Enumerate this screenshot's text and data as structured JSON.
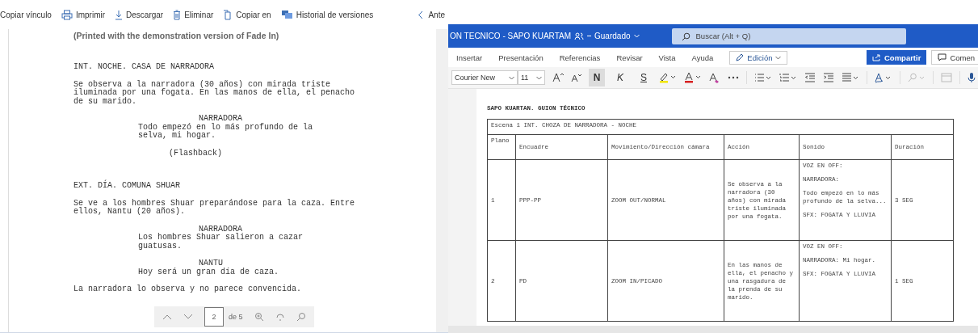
{
  "pdf_viewer": {
    "toolbar": [
      "Copiar vínculo",
      "Imprimir",
      "Descargar",
      "Eliminar",
      "Copiar en",
      "Historial de versiones"
    ],
    "back_link": "Ante",
    "notice": "(Printed with the demonstration version of Fade In)",
    "script": [
      {
        "kind": "heading",
        "text": "INT. NOCHE. CASA DE NARRADORA"
      },
      {
        "kind": "action",
        "text": "Se observa a la narradora (30 años) con mirada triste\niluminada por una fogata. En las manos de ella, el penacho\nde su marido."
      },
      {
        "kind": "character",
        "text": "NARRADORA"
      },
      {
        "kind": "dialogue",
        "text": "Todo empezó en lo más profundo de la\nselva, mi hogar."
      },
      {
        "kind": "parenthetical",
        "text": "(Flashback)"
      },
      {
        "kind": "heading",
        "text": "EXT. DÍA. COMUNA SHUAR"
      },
      {
        "kind": "action",
        "text": "Se ve a los hombres Shuar preparándose para la caza. Entre\nellos, Nantu (20 años)."
      },
      {
        "kind": "character",
        "text": "NARRADORA"
      },
      {
        "kind": "dialogue",
        "text": "Los hombres Shuar salieron a cazar\nguatusas."
      },
      {
        "kind": "character",
        "text": "NANTU"
      },
      {
        "kind": "dialogue",
        "text": "Hoy será un gran día de caza."
      },
      {
        "kind": "action",
        "text": "La narradora lo observa y no parece convencida."
      }
    ],
    "pager": {
      "page": "2",
      "of": "de 5"
    }
  },
  "word": {
    "title": "ON TECNICO - SAPO KUARTAM",
    "saved": "Guardado",
    "search_placeholder": "Buscar (Alt + Q)",
    "ribbon_tabs": [
      "Insertar",
      "Presentación",
      "Referencias",
      "Revisar",
      "Vista",
      "Ayuda"
    ],
    "mode": "Edición",
    "share": "Compartir",
    "comment": "Comen",
    "font": "Courier New",
    "size": "11",
    "format_buttons": [
      {
        "label": "N",
        "kind": "bold",
        "selected": true
      },
      {
        "label": "K",
        "kind": "italic",
        "selected": false
      },
      {
        "label": "S",
        "kind": "underline",
        "selected": false
      }
    ],
    "doc_title": "SAPO KUARTAN. GUION TÉCNICO",
    "table": {
      "scene": "Escena 1 INT. CHOZA DE NARRADORA - NOCHE",
      "columns": [
        "Plano",
        "Encuadre",
        "Movimiento/Dirección cámara",
        "Acción",
        "Sonido",
        "Duración"
      ],
      "rows": [
        {
          "plano": "1",
          "encuadre": "PPP-PP",
          "movimiento": "ZOOM OUT/NORMAL",
          "accion": "Se observa a la narradora (30 años) con mirada triste iluminada por una fogata.",
          "sonido": [
            "VOZ EN OFF:",
            "NARRADORA:",
            "Todo empezó en lo más profundo de la selva...",
            "SFX: FOGATA Y LLUVIA"
          ],
          "duracion": "3 SEG"
        },
        {
          "plano": "2",
          "encuadre": "PD",
          "movimiento": "ZOOM IN/PICADO",
          "accion": "En las manos de ella, el penacho y una rasgadura de la prenda de su marido.",
          "sonido": [
            "VOZ EN OFF:",
            "NARRADORA: Mi hogar.",
            "SFX: FOGATA Y LLUVIA"
          ],
          "duracion": "1 SEG"
        }
      ]
    }
  }
}
